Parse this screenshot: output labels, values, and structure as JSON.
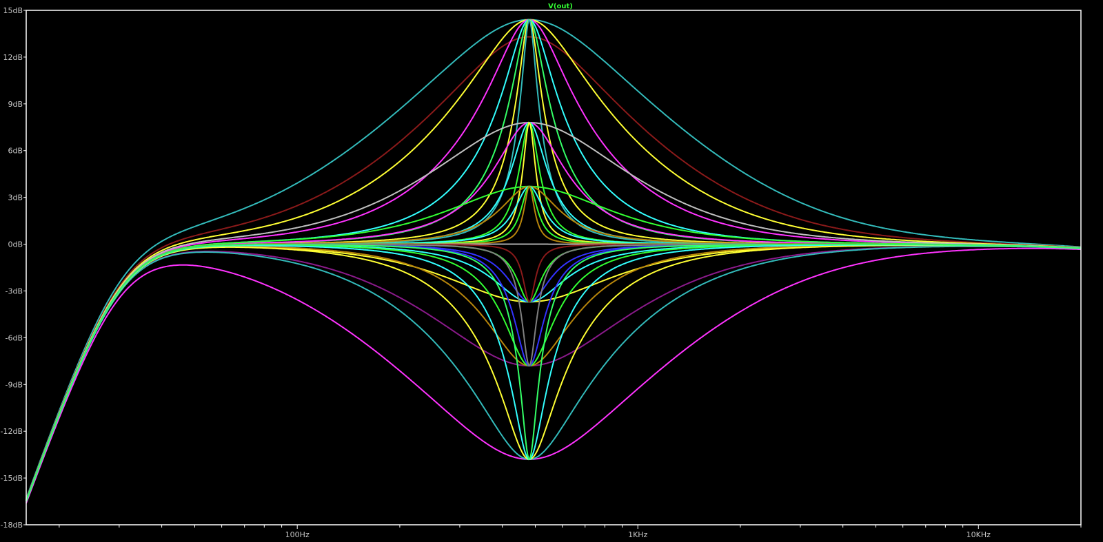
{
  "chart_data": {
    "type": "line",
    "title": "V(out)",
    "title_color": "#33ff33",
    "background": "#000000",
    "frame_color": "#ffffff",
    "x_scale": "log",
    "x_unit": "Hz",
    "xlim": [
      16,
      20000
    ],
    "ylim": [
      -18,
      15
    ],
    "y_unit": "dB",
    "grid": false,
    "y_ticks": [
      {
        "value": 15,
        "label": "15dB"
      },
      {
        "value": 12,
        "label": "12dB"
      },
      {
        "value": 9,
        "label": "9dB"
      },
      {
        "value": 6,
        "label": "6dB"
      },
      {
        "value": 3,
        "label": "3dB"
      },
      {
        "value": 0,
        "label": "0dB"
      },
      {
        "value": -3,
        "label": "-3dB"
      },
      {
        "value": -6,
        "label": "-6dB"
      },
      {
        "value": -9,
        "label": "-9dB"
      },
      {
        "value": -12,
        "label": "-12dB"
      },
      {
        "value": -15,
        "label": "-15dB"
      },
      {
        "value": -18,
        "label": "-18dB"
      }
    ],
    "x_ticks": [
      {
        "value": 100,
        "label": "100Hz"
      },
      {
        "value": 1000,
        "label": "1KHz"
      },
      {
        "value": 10000,
        "label": "10KHz"
      }
    ],
    "center_frequency_hz": 480,
    "highpass_corner_hz": 30,
    "series": [
      {
        "color": "#33bbbb",
        "peak_db": 14.4,
        "q": 0.9
      },
      {
        "color": "#8b1a1a",
        "peak_db": 13.3,
        "q": 1.1
      },
      {
        "color": "#ffff33",
        "peak_db": 14.4,
        "q": 1.6
      },
      {
        "color": "#ff33ff",
        "peak_db": 14.4,
        "q": 2.5
      },
      {
        "color": "#33ffff",
        "peak_db": 14.4,
        "q": 4.0
      },
      {
        "color": "#33ff66",
        "peak_db": 14.4,
        "q": 6.0
      },
      {
        "color": "#ffff33",
        "peak_db": 14.4,
        "q": 9.0
      },
      {
        "color": "#33bbbb",
        "peak_db": 14.4,
        "q": 13.0
      },
      {
        "color": "#c0c0c0",
        "peak_db": 7.8,
        "q": 0.9
      },
      {
        "color": "#ff33ff",
        "peak_db": 7.8,
        "q": 2.5
      },
      {
        "color": "#33ffff",
        "peak_db": 7.8,
        "q": 5.0
      },
      {
        "color": "#33ff33",
        "peak_db": 7.8,
        "q": 9.0
      },
      {
        "color": "#ffff33",
        "peak_db": 7.8,
        "q": 14.0
      },
      {
        "color": "#33ff33",
        "peak_db": 3.7,
        "q": 0.9
      },
      {
        "color": "#b8860b",
        "peak_db": 3.7,
        "q": 2.5
      },
      {
        "color": "#33ffff",
        "peak_db": 3.7,
        "q": 5.0
      },
      {
        "color": "#33ff33",
        "peak_db": 3.7,
        "q": 9.0
      },
      {
        "color": "#b8860b",
        "peak_db": 3.7,
        "q": 14.0
      },
      {
        "color": "#aaaaaa",
        "peak_db": 0.0,
        "q": 2.0
      },
      {
        "color": "#ffff33",
        "peak_db": -3.7,
        "q": 0.9
      },
      {
        "color": "#33ffff",
        "peak_db": -3.7,
        "q": 2.0
      },
      {
        "color": "#3333ff",
        "peak_db": -3.7,
        "q": 3.5
      },
      {
        "color": "#33ff33",
        "peak_db": -3.7,
        "q": 6.0
      },
      {
        "color": "#8b1a1a",
        "peak_db": -3.7,
        "q": 12.0
      },
      {
        "color": "#8b1a8b",
        "peak_db": -7.8,
        "q": 0.9
      },
      {
        "color": "#b8860b",
        "peak_db": -7.8,
        "q": 2.0
      },
      {
        "color": "#33ff33",
        "peak_db": -7.8,
        "q": 3.5
      },
      {
        "color": "#3333ff",
        "peak_db": -7.8,
        "q": 6.0
      },
      {
        "color": "#808080",
        "peak_db": -7.8,
        "q": 12.0
      },
      {
        "color": "#ff33ff",
        "peak_db": -13.8,
        "q": 0.9
      },
      {
        "color": "#33bbbb",
        "peak_db": -13.8,
        "q": 1.8
      },
      {
        "color": "#ffff33",
        "peak_db": -13.8,
        "q": 3.5
      },
      {
        "color": "#33ffff",
        "peak_db": -13.8,
        "q": 6.0
      },
      {
        "color": "#33ff66",
        "peak_db": -13.8,
        "q": 12.0
      }
    ]
  }
}
